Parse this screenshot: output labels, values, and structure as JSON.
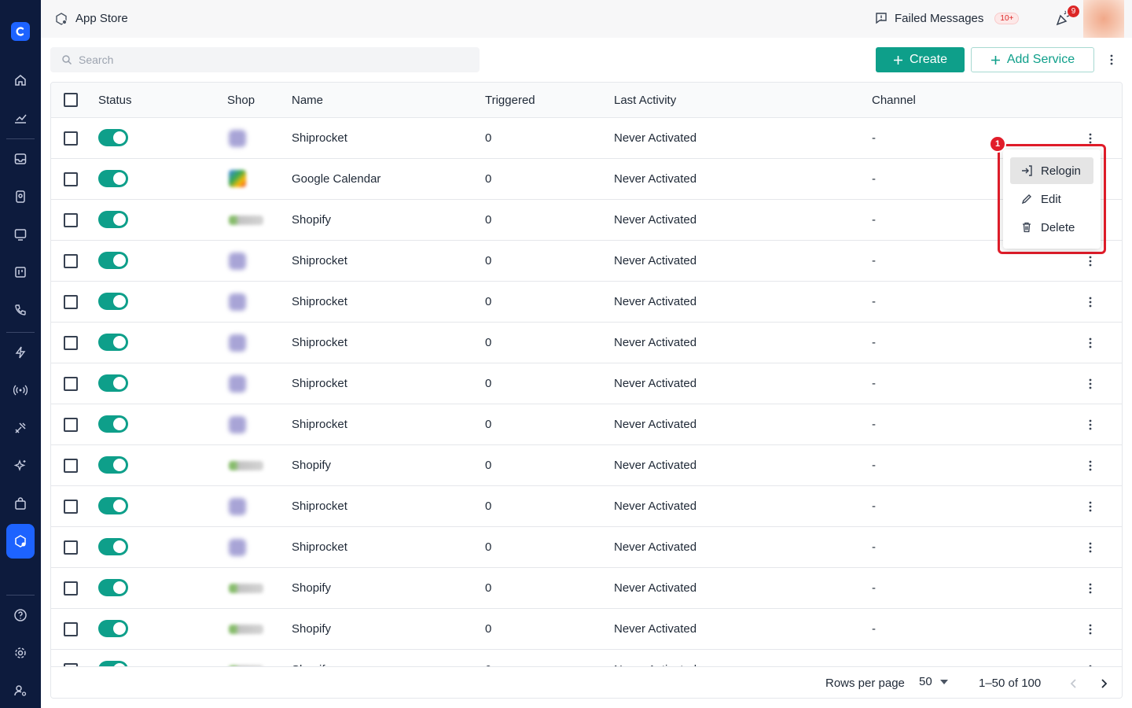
{
  "topbar": {
    "app_title": "App Store",
    "failed_messages_label": "Failed Messages",
    "failed_messages_badge": "10+",
    "notification_count": "9"
  },
  "toolbar": {
    "search_placeholder": "Search",
    "create_label": "Create",
    "add_service_label": "Add Service"
  },
  "table": {
    "columns": [
      "Status",
      "Shop",
      "Name",
      "Triggered",
      "Last Activity",
      "Channel"
    ],
    "rows": [
      {
        "shop": "shiprocket",
        "name": "Shiprocket",
        "triggered": "0",
        "last_activity": "Never Activated",
        "channel": "-",
        "enabled": true
      },
      {
        "shop": "google-calendar",
        "name": "Google Calendar",
        "triggered": "0",
        "last_activity": "Never Activated",
        "channel": "-",
        "enabled": true
      },
      {
        "shop": "shopify",
        "name": "Shopify",
        "triggered": "0",
        "last_activity": "Never Activated",
        "channel": "-",
        "enabled": true
      },
      {
        "shop": "shiprocket",
        "name": "Shiprocket",
        "triggered": "0",
        "last_activity": "Never Activated",
        "channel": "-",
        "enabled": true
      },
      {
        "shop": "shiprocket",
        "name": "Shiprocket",
        "triggered": "0",
        "last_activity": "Never Activated",
        "channel": "-",
        "enabled": true
      },
      {
        "shop": "shiprocket",
        "name": "Shiprocket",
        "triggered": "0",
        "last_activity": "Never Activated",
        "channel": "-",
        "enabled": true
      },
      {
        "shop": "shiprocket",
        "name": "Shiprocket",
        "triggered": "0",
        "last_activity": "Never Activated",
        "channel": "-",
        "enabled": true
      },
      {
        "shop": "shiprocket",
        "name": "Shiprocket",
        "triggered": "0",
        "last_activity": "Never Activated",
        "channel": "-",
        "enabled": true
      },
      {
        "shop": "shopify",
        "name": "Shopify",
        "triggered": "0",
        "last_activity": "Never Activated",
        "channel": "-",
        "enabled": true
      },
      {
        "shop": "shiprocket",
        "name": "Shiprocket",
        "triggered": "0",
        "last_activity": "Never Activated",
        "channel": "-",
        "enabled": true
      },
      {
        "shop": "shiprocket",
        "name": "Shiprocket",
        "triggered": "0",
        "last_activity": "Never Activated",
        "channel": "-",
        "enabled": true
      },
      {
        "shop": "shopify",
        "name": "Shopify",
        "triggered": "0",
        "last_activity": "Never Activated",
        "channel": "-",
        "enabled": true
      },
      {
        "shop": "shopify",
        "name": "Shopify",
        "triggered": "0",
        "last_activity": "Never Activated",
        "channel": "-",
        "enabled": true
      },
      {
        "shop": "shopify",
        "name": "Shopify",
        "triggered": "0",
        "last_activity": "Never Activated",
        "channel": "-",
        "enabled": true
      }
    ]
  },
  "row_menu": {
    "items": [
      "Relogin",
      "Edit",
      "Delete"
    ],
    "step_marker": "1"
  },
  "pagination": {
    "rows_per_page_label": "Rows per page",
    "rows_per_page_value": "50",
    "range_label": "1–50 of 100"
  },
  "colors": {
    "sidebar": "#0d1b3d",
    "accent": "#1d63ff",
    "primary": "#0e9f8a",
    "highlight": "#e11d2a"
  }
}
